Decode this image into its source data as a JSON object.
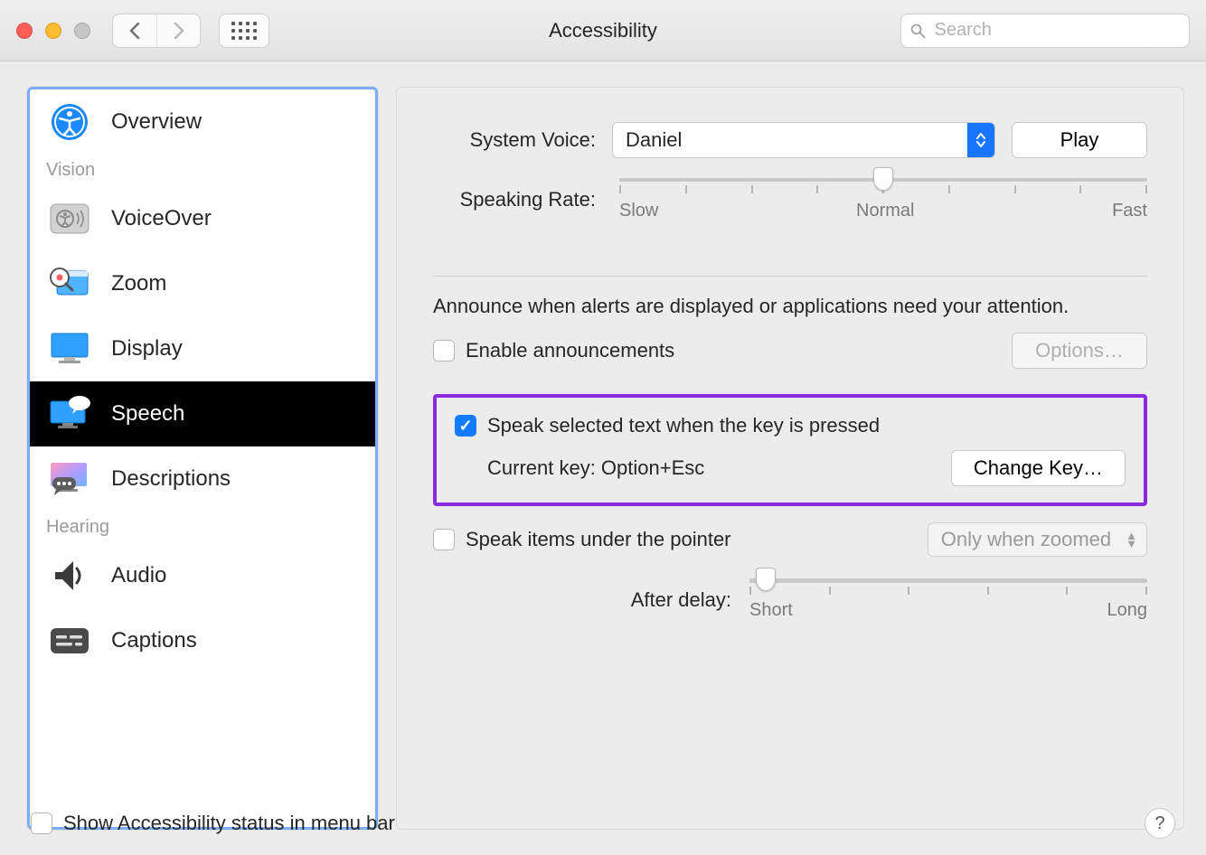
{
  "window": {
    "title": "Accessibility"
  },
  "search": {
    "placeholder": "Search"
  },
  "sidebar": {
    "sections": {
      "vision_label": "Vision",
      "hearing_label": "Hearing"
    },
    "items": {
      "overview": "Overview",
      "voiceover": "VoiceOver",
      "zoom": "Zoom",
      "display": "Display",
      "speech": "Speech",
      "descriptions": "Descriptions",
      "audio": "Audio",
      "captions": "Captions"
    },
    "selected": "speech"
  },
  "voice": {
    "system_voice_label": "System Voice:",
    "selected_voice": "Daniel",
    "play_label": "Play"
  },
  "rate": {
    "label": "Speaking Rate:",
    "ticks": {
      "slow": "Slow",
      "normal": "Normal",
      "fast": "Fast"
    },
    "value_percent": 50
  },
  "announce": {
    "description": "Announce when alerts are displayed or applications need your attention.",
    "enable_label": "Enable announcements",
    "enable_checked": false,
    "options_label": "Options…"
  },
  "speak_key": {
    "enable_label": "Speak selected text when the key is pressed",
    "enable_checked": true,
    "current_key_label": "Current key: Option+Esc",
    "change_key_label": "Change Key…"
  },
  "pointer": {
    "enable_label": "Speak items under the pointer",
    "enable_checked": false,
    "mode": "Only when zoomed",
    "delay_label": "After delay:",
    "ticks": {
      "short": "Short",
      "long": "Long"
    },
    "value_percent": 4
  },
  "footer": {
    "show_status_label": "Show Accessibility status in menu bar",
    "show_status_checked": false,
    "help": "?"
  }
}
